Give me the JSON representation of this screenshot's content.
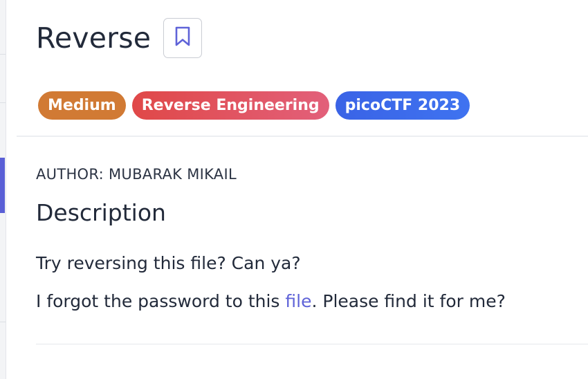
{
  "challenge": {
    "title": "Reverse",
    "bookmark_icon": "bookmark-icon",
    "tags": {
      "difficulty": "Medium",
      "category": "Reverse Engineering",
      "event": "picoCTF 2023"
    },
    "author": "AUTHOR: MUBARAK MIKAIL",
    "description_heading": "Description",
    "description": {
      "line1": "Try reversing this file? Can ya?",
      "line2_before": "I forgot the password to this ",
      "line2_link": "file",
      "line2_after": ". Please find it for me?"
    }
  },
  "colors": {
    "accent": "#5f63d8",
    "difficulty_medium": "#d17a34",
    "category": "#e04848",
    "event": "#3a63e6"
  }
}
